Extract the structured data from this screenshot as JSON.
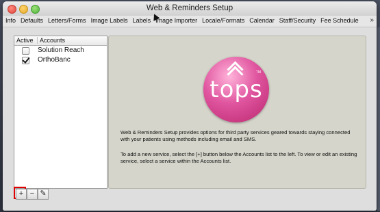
{
  "window": {
    "title": "Web & Reminders Setup"
  },
  "toolbar": {
    "tabs": [
      "Info",
      "Defaults",
      "Letters/Forms",
      "Image Labels",
      "Labels",
      "Image Importer",
      "Locale/Formats",
      "Calendar",
      "Staff/Security",
      "Fee Schedule"
    ],
    "overflow": "»"
  },
  "accounts": {
    "header_active": "Active",
    "header_accounts": "Accounts",
    "rows": [
      {
        "name": "Solution Reach",
        "active": false
      },
      {
        "name": "OrthoBanc",
        "active": true
      }
    ]
  },
  "buttons": {
    "add": "+",
    "remove": "−",
    "edit": "✎"
  },
  "logo": {
    "word": "tops",
    "tm": "TM"
  },
  "panel": {
    "paragraph1": "Web & Reminders Setup provides options for third party services geared towards staying connected with your patients using methods including email and SMS.",
    "paragraph2": "To add a new service, select the [+] button below the Accounts list to the left. To view or edit an existing service, select a service within the Accounts list."
  },
  "colors": {
    "logo": "#d94a96",
    "highlight": "#e00000"
  }
}
